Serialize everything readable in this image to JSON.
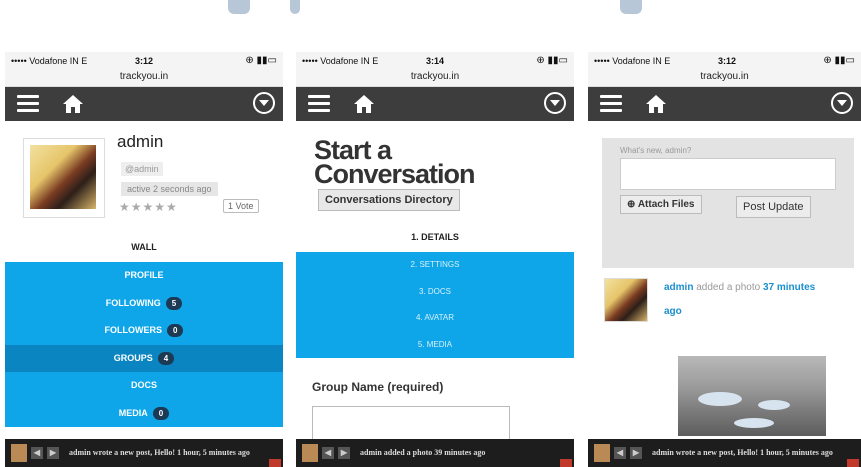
{
  "phones": [
    {
      "status": {
        "carrier": "••••• Vodafone IN  E",
        "time": "3:12",
        "battery": "⊕ ▮▮▭"
      },
      "url": "trackyou.in",
      "profile": {
        "name": "admin",
        "handle": "@admin",
        "active": "active 2 seconds ago",
        "stars": "★★★★★",
        "votes": "1 Vote"
      },
      "wall_label": "WALL",
      "menu": [
        {
          "label": "PROFILE",
          "count": null
        },
        {
          "label": "FOLLOWING",
          "count": "5"
        },
        {
          "label": "FOLLOWERS",
          "count": "0"
        },
        {
          "label": "GROUPS",
          "count": "4"
        },
        {
          "label": "DOCS",
          "count": null
        },
        {
          "label": "MEDIA",
          "count": "0"
        }
      ],
      "ticker": "admin wrote a new post, Hello! 1 hour, 5 minutes ago"
    },
    {
      "status": {
        "carrier": "••••• Vodafone IN  E",
        "time": "3:14",
        "battery": "⊕ ▮▮▭"
      },
      "url": "trackyou.in",
      "title_line1": "Start a",
      "title_line2": "Conversation",
      "directory_button": "Conversations Directory",
      "details_label": "1. DETAILS",
      "steps": [
        "2. SETTINGS",
        "3. DOCS",
        "4. AVATAR",
        "5. MEDIA"
      ],
      "group_name_label": "Group Name (required)",
      "ticker": "admin added a photo 39 minutes ago"
    },
    {
      "status": {
        "carrier": "••••• Vodafone IN  E",
        "time": "3:12",
        "battery": "⊕ ▮▮▭"
      },
      "url": "trackyou.in",
      "whats_new_placeholder": "What's new, admin?",
      "attach_button": "Attach Files",
      "post_button": "Post Update",
      "activity": {
        "user": "admin",
        "action": "added a photo",
        "time": "37 minutes ago"
      },
      "ticker": "admin wrote a new post, Hello! 1 hour, 5 minutes ago"
    }
  ],
  "colors": {
    "accent": "#0ea6e8",
    "accent_selected": "#0a85c1",
    "navbar": "#3d3d3d",
    "bottom_bar": "#1d1d1d",
    "link": "#1a8fd0"
  }
}
